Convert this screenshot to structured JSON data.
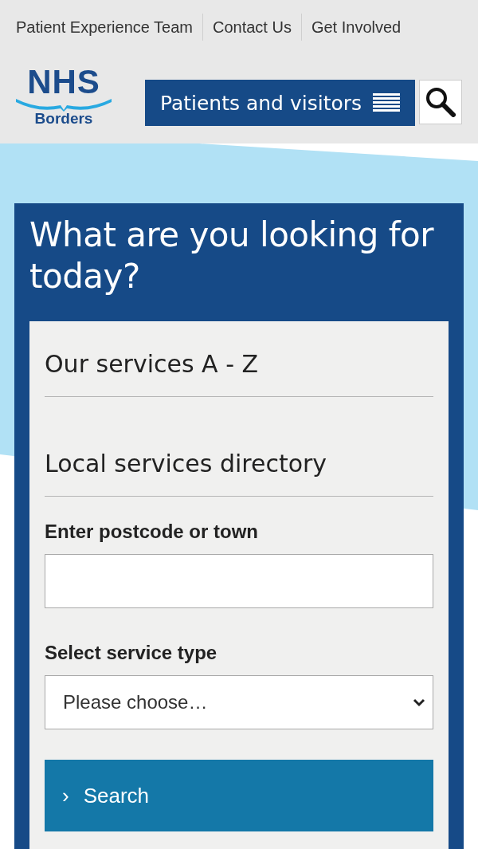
{
  "top_links": [
    "Patient Experience Team",
    "Contact Us",
    "Get Involved"
  ],
  "logo": {
    "title": "NHS",
    "subtitle": "Borders"
  },
  "nav_button": {
    "label": "Patients and visitors"
  },
  "finder": {
    "heading": "What are you looking for today?",
    "links": [
      "Our services A - Z",
      "Local services directory"
    ],
    "postcode_field": {
      "label": "Enter postcode or town"
    },
    "service_select": {
      "label": "Select service type",
      "value": "Please choose…"
    },
    "search_button": {
      "icon": "›",
      "label": "Search"
    }
  }
}
